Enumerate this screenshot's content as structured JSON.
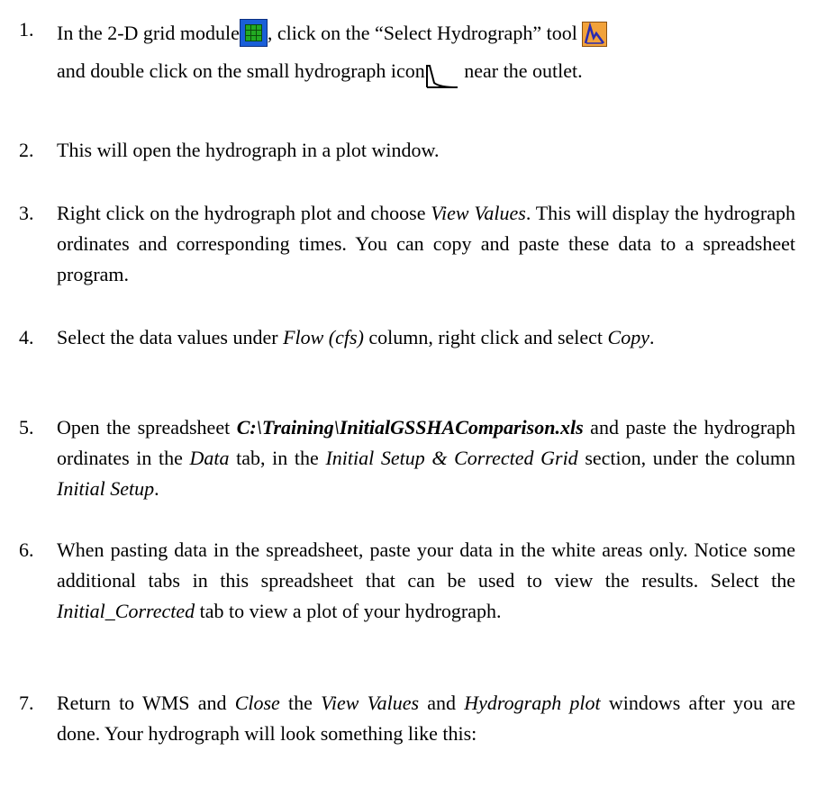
{
  "steps": [
    {
      "number": "1.",
      "t1": "In the 2-D grid module",
      "t2": ", click on the “Select Hydrograph” tool",
      "t3": " and double click on the small hydrograph icon",
      "t4": " near the outlet."
    },
    {
      "number": "2.",
      "t1": "This will open the hydrograph in a plot window."
    },
    {
      "number": "3.",
      "t1": "Right click on the hydrograph plot and choose ",
      "i1": "View Values",
      "t2": ". This will display the hydrograph ordinates and corresponding times. You can copy and paste these data to a spreadsheet program."
    },
    {
      "number": "4.",
      "t1": "Select the data values under ",
      "i1": "Flow (cfs)",
      "t2": " column, right click and select ",
      "i2": "Copy",
      "t3": "."
    },
    {
      "number": "5.",
      "t1": "Open the spreadsheet ",
      "b1": "C:\\Training\\InitialGSSHAComparison.xls",
      "t2": " and paste the hydrograph ordinates in the ",
      "i1": "Data",
      "t3": " tab, in the ",
      "i2": "Initial Setup & Corrected Grid",
      "t4": " section, under the column ",
      "i3": "Initial Setup",
      "t5": "."
    },
    {
      "number": "6.",
      "t1": "When pasting data in the spreadsheet, paste your data in the white areas only.  Notice some additional tabs in this spreadsheet that can be used to view the results.  Select the ",
      "i1": "Initial_Corrected",
      "t2": " tab to view a plot of your hydrograph."
    },
    {
      "number": "7.",
      "t1": "Return to WMS and ",
      "i1": "Close",
      "t2": " the ",
      "i2": "View Values",
      "t3": " and ",
      "i3": "Hydrograph plot",
      "t4": " windows after you are done. Your hydrograph will look something like this:"
    }
  ],
  "icons": {
    "grid_module": "2d-grid-module-icon",
    "select_hydrograph_tool": "select-hydrograph-tool-icon",
    "small_hydrograph": "small-hydrograph-icon"
  },
  "colors": {
    "grid_icon_bg": "#1a5fd8",
    "grid_icon_inner": "#22aa22",
    "tool_icon_bg": "#f2a23a",
    "tool_icon_glyph": "#2b2bb0"
  }
}
